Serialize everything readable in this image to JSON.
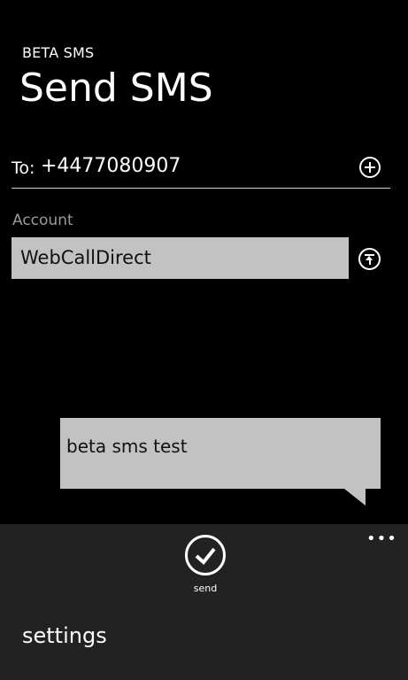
{
  "header": {
    "app_name": "BETA SMS",
    "page_title": "Send SMS"
  },
  "recipient": {
    "label": "To:",
    "value": "+4477080907",
    "add_icon": "add-circle-icon"
  },
  "account": {
    "label": "Account",
    "value": "WebCallDirect",
    "select_icon": "upload-circle-icon"
  },
  "message": {
    "text": "beta sms test"
  },
  "app_bar": {
    "more": "•••",
    "send_label": "send",
    "send_icon": "check-circle-icon",
    "menu_items": [
      "settings"
    ]
  },
  "colors": {
    "background": "#000000",
    "app_bar": "#222222",
    "field": "#c2c2c2",
    "muted_text": "#9a9a9a"
  }
}
